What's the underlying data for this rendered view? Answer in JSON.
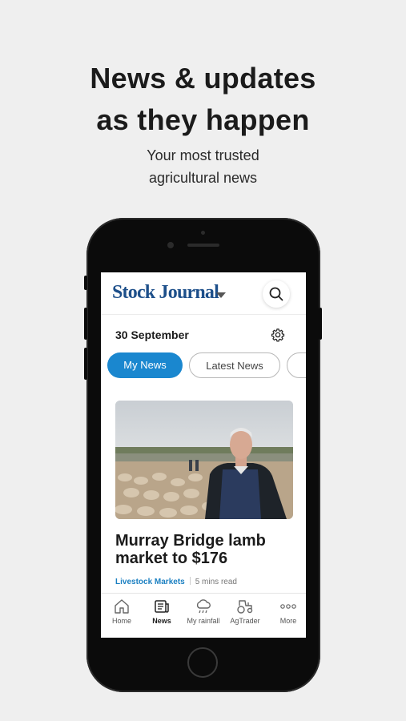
{
  "promo": {
    "headline_line1": "News & updates",
    "headline_line2": "as they happen",
    "subline_line1": "Your most trusted",
    "subline_line2": "agricultural news"
  },
  "app": {
    "brand": "Stock Journal",
    "date": "30 September",
    "tabs": [
      {
        "label": "My News",
        "active": true
      },
      {
        "label": "Latest News",
        "active": false
      }
    ],
    "article": {
      "title": "Murray Bridge lamb market to $176",
      "category": "Livestock Markets",
      "read_time": "5 mins read"
    },
    "nav": [
      {
        "label": "Home",
        "icon": "home-icon"
      },
      {
        "label": "News",
        "icon": "news-icon",
        "active": true
      },
      {
        "label": "My rainfall",
        "icon": "rain-cloud-icon"
      },
      {
        "label": "AgTrader",
        "icon": "tractor-icon"
      },
      {
        "label": "More",
        "icon": "more-dots-icon"
      }
    ]
  },
  "colors": {
    "accent": "#1a87cf",
    "brand": "#1d4f8a",
    "category": "#1a7fc1"
  }
}
